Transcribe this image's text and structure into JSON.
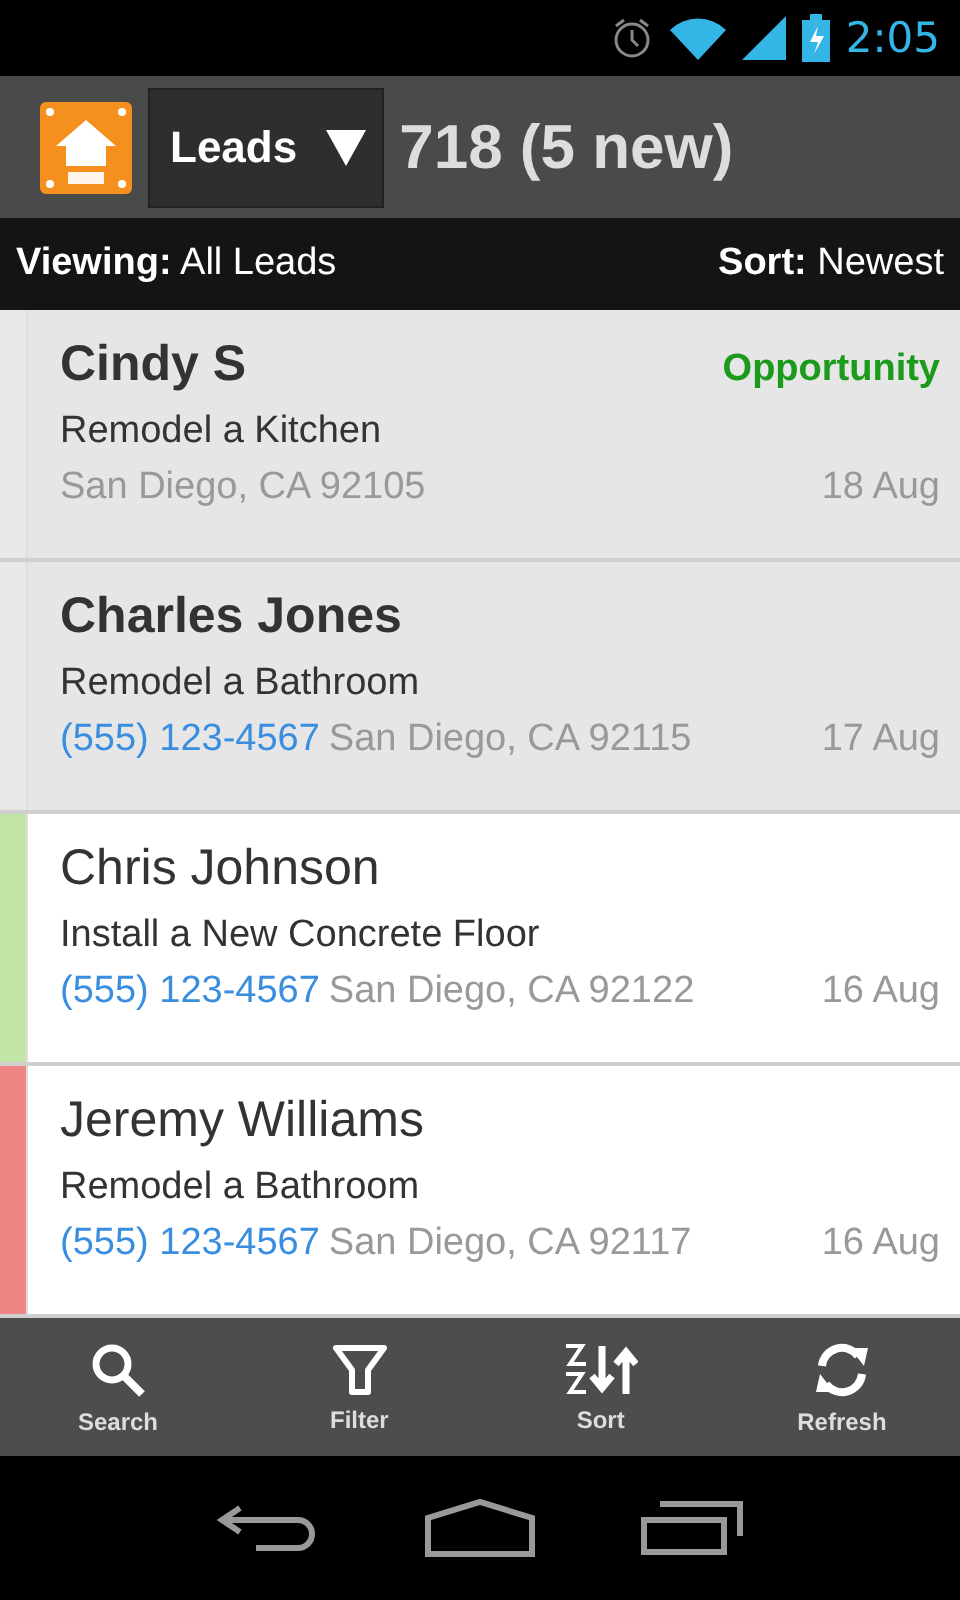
{
  "status_bar": {
    "time": "2:05"
  },
  "app_bar": {
    "spinner": "Leads",
    "count": "718 (5 new)"
  },
  "filter_bar": {
    "viewing_label": "Viewing:",
    "viewing_value": "All Leads",
    "sort_label": "Sort:",
    "sort_value": "Newest"
  },
  "leads": [
    {
      "name": "Cindy S",
      "new": true,
      "color": "#e8e8e8",
      "tag": "Opportunity",
      "project": "Remodel a Kitchen",
      "location": "San Diego, CA 92105",
      "date": "18 Aug"
    },
    {
      "name": "Charles Jones",
      "new": true,
      "color": "#e8e8e8",
      "project": "Remodel a Bathroom",
      "phone": "(555) 123-4567",
      "location": "San Diego, CA 92115",
      "date": "17 Aug"
    },
    {
      "name": "Chris Johnson",
      "new": false,
      "color": "#c2e5a6",
      "project": "Install a New Concrete Floor",
      "phone": "(555) 123-4567",
      "location": "San Diego, CA 92122",
      "date": "16 Aug"
    },
    {
      "name": "Jeremy Williams",
      "new": false,
      "color": "#f08585",
      "project": "Remodel a Bathroom",
      "phone": "(555) 123-4567",
      "location": "San Diego, CA 92117",
      "date": "16 Aug"
    }
  ],
  "toolbar": [
    {
      "kind": "search",
      "label": "Search"
    },
    {
      "kind": "filter",
      "label": "Filter"
    },
    {
      "kind": "sort",
      "label": "Sort"
    },
    {
      "kind": "refresh",
      "label": "Refresh"
    }
  ]
}
